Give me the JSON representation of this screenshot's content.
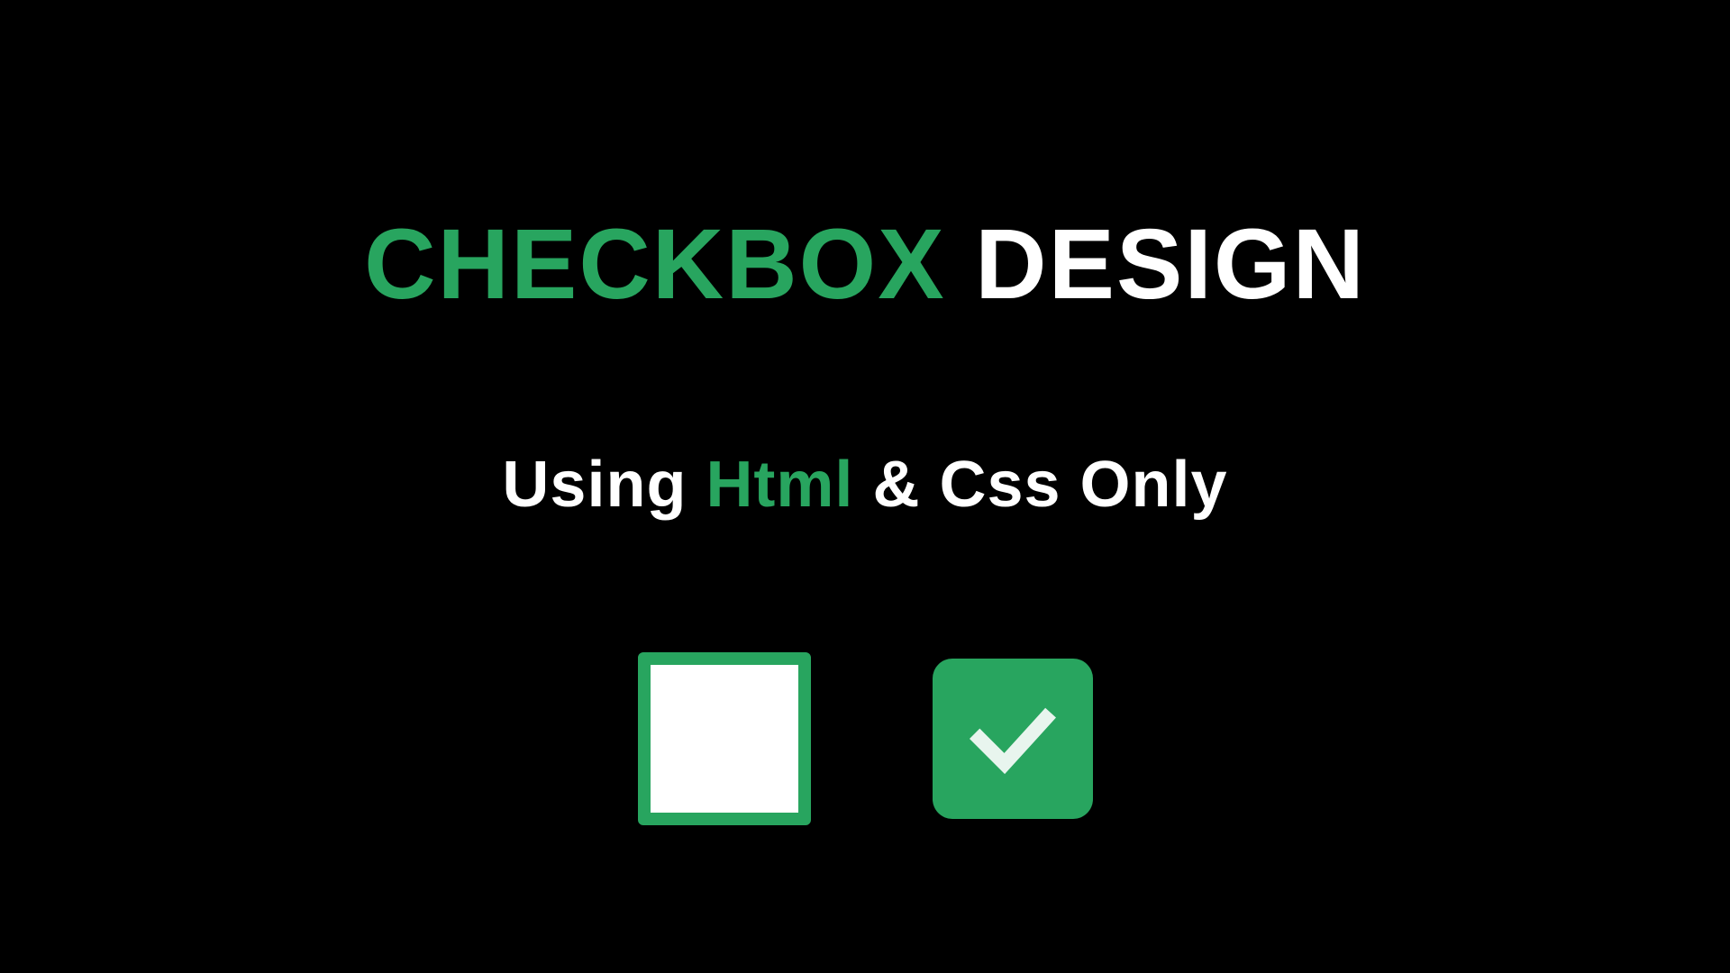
{
  "title": {
    "word1": "CHECKBOX",
    "word2": "DESIGN"
  },
  "subtitle": {
    "part1": "Using ",
    "part2": "Html",
    "part3": " & Css Only"
  },
  "colors": {
    "accent": "#28a55f",
    "background": "#000000",
    "text": "#ffffff"
  },
  "checkboxes": {
    "unchecked": {
      "state": "unchecked"
    },
    "checked": {
      "state": "checked"
    }
  }
}
